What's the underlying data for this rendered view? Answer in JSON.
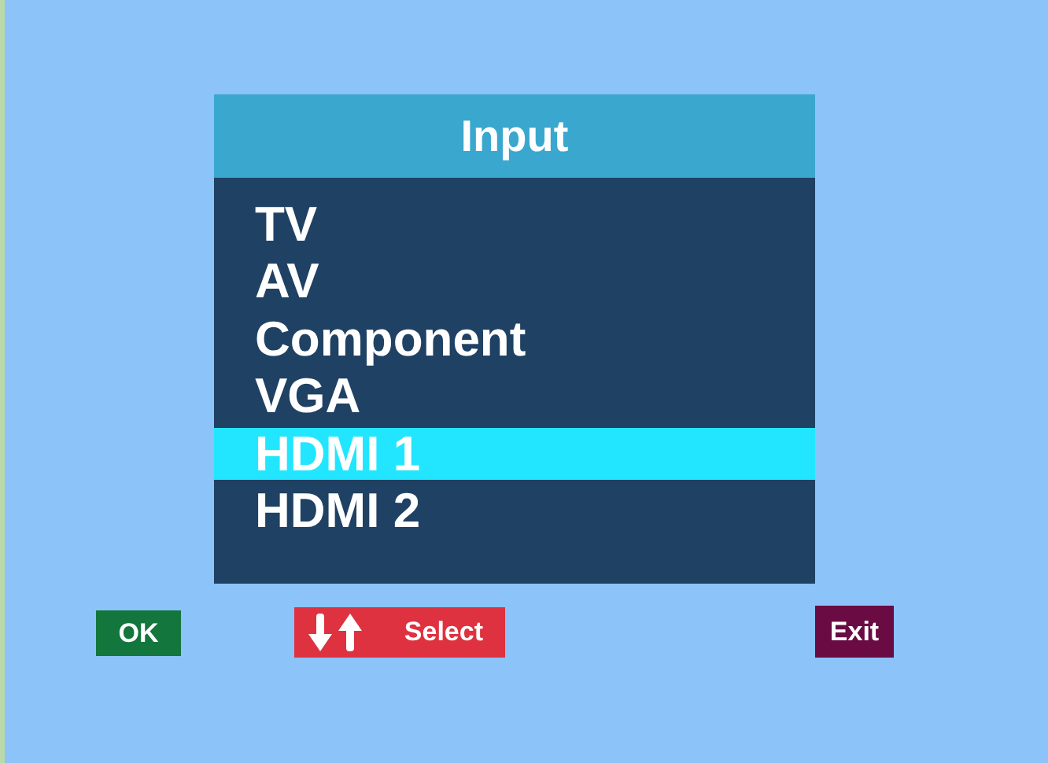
{
  "menu": {
    "title": "Input",
    "items": [
      {
        "label": "TV",
        "selected": false
      },
      {
        "label": "AV",
        "selected": false
      },
      {
        "label": "Component",
        "selected": false
      },
      {
        "label": "VGA",
        "selected": false
      },
      {
        "label": "HDMI 1",
        "selected": true
      },
      {
        "label": "HDMI 2",
        "selected": false
      }
    ]
  },
  "buttons": [
    {
      "kind": "ok",
      "label": "OK"
    },
    {
      "kind": "select",
      "label": "Select"
    },
    {
      "kind": "exit",
      "label": "Exit"
    }
  ]
}
